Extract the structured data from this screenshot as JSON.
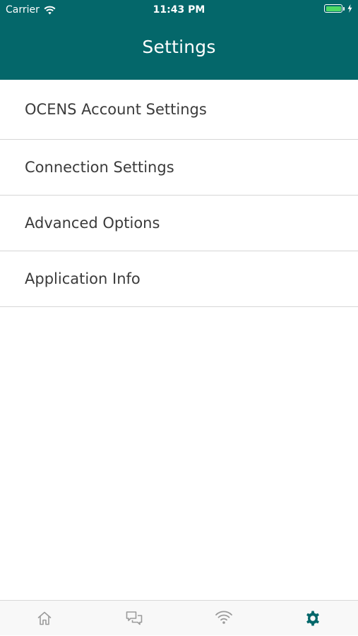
{
  "status_bar": {
    "carrier": "Carrier",
    "time": "11:43 PM",
    "battery_color": "#4cd964"
  },
  "header": {
    "title": "Settings",
    "background": "#04676a"
  },
  "settings_list": {
    "items": [
      {
        "label": "OCENS Account Settings"
      },
      {
        "label": "Connection Settings"
      },
      {
        "label": "Advanced Options"
      },
      {
        "label": "Application Info"
      }
    ]
  },
  "tab_bar": {
    "tabs": [
      {
        "icon": "home-icon",
        "active": false
      },
      {
        "icon": "chat-bubbles-icon",
        "active": false
      },
      {
        "icon": "wifi-icon",
        "active": false
      },
      {
        "icon": "gear-icon",
        "active": true
      }
    ],
    "active_color": "#04676a",
    "inactive_color": "#9b9b9b"
  }
}
